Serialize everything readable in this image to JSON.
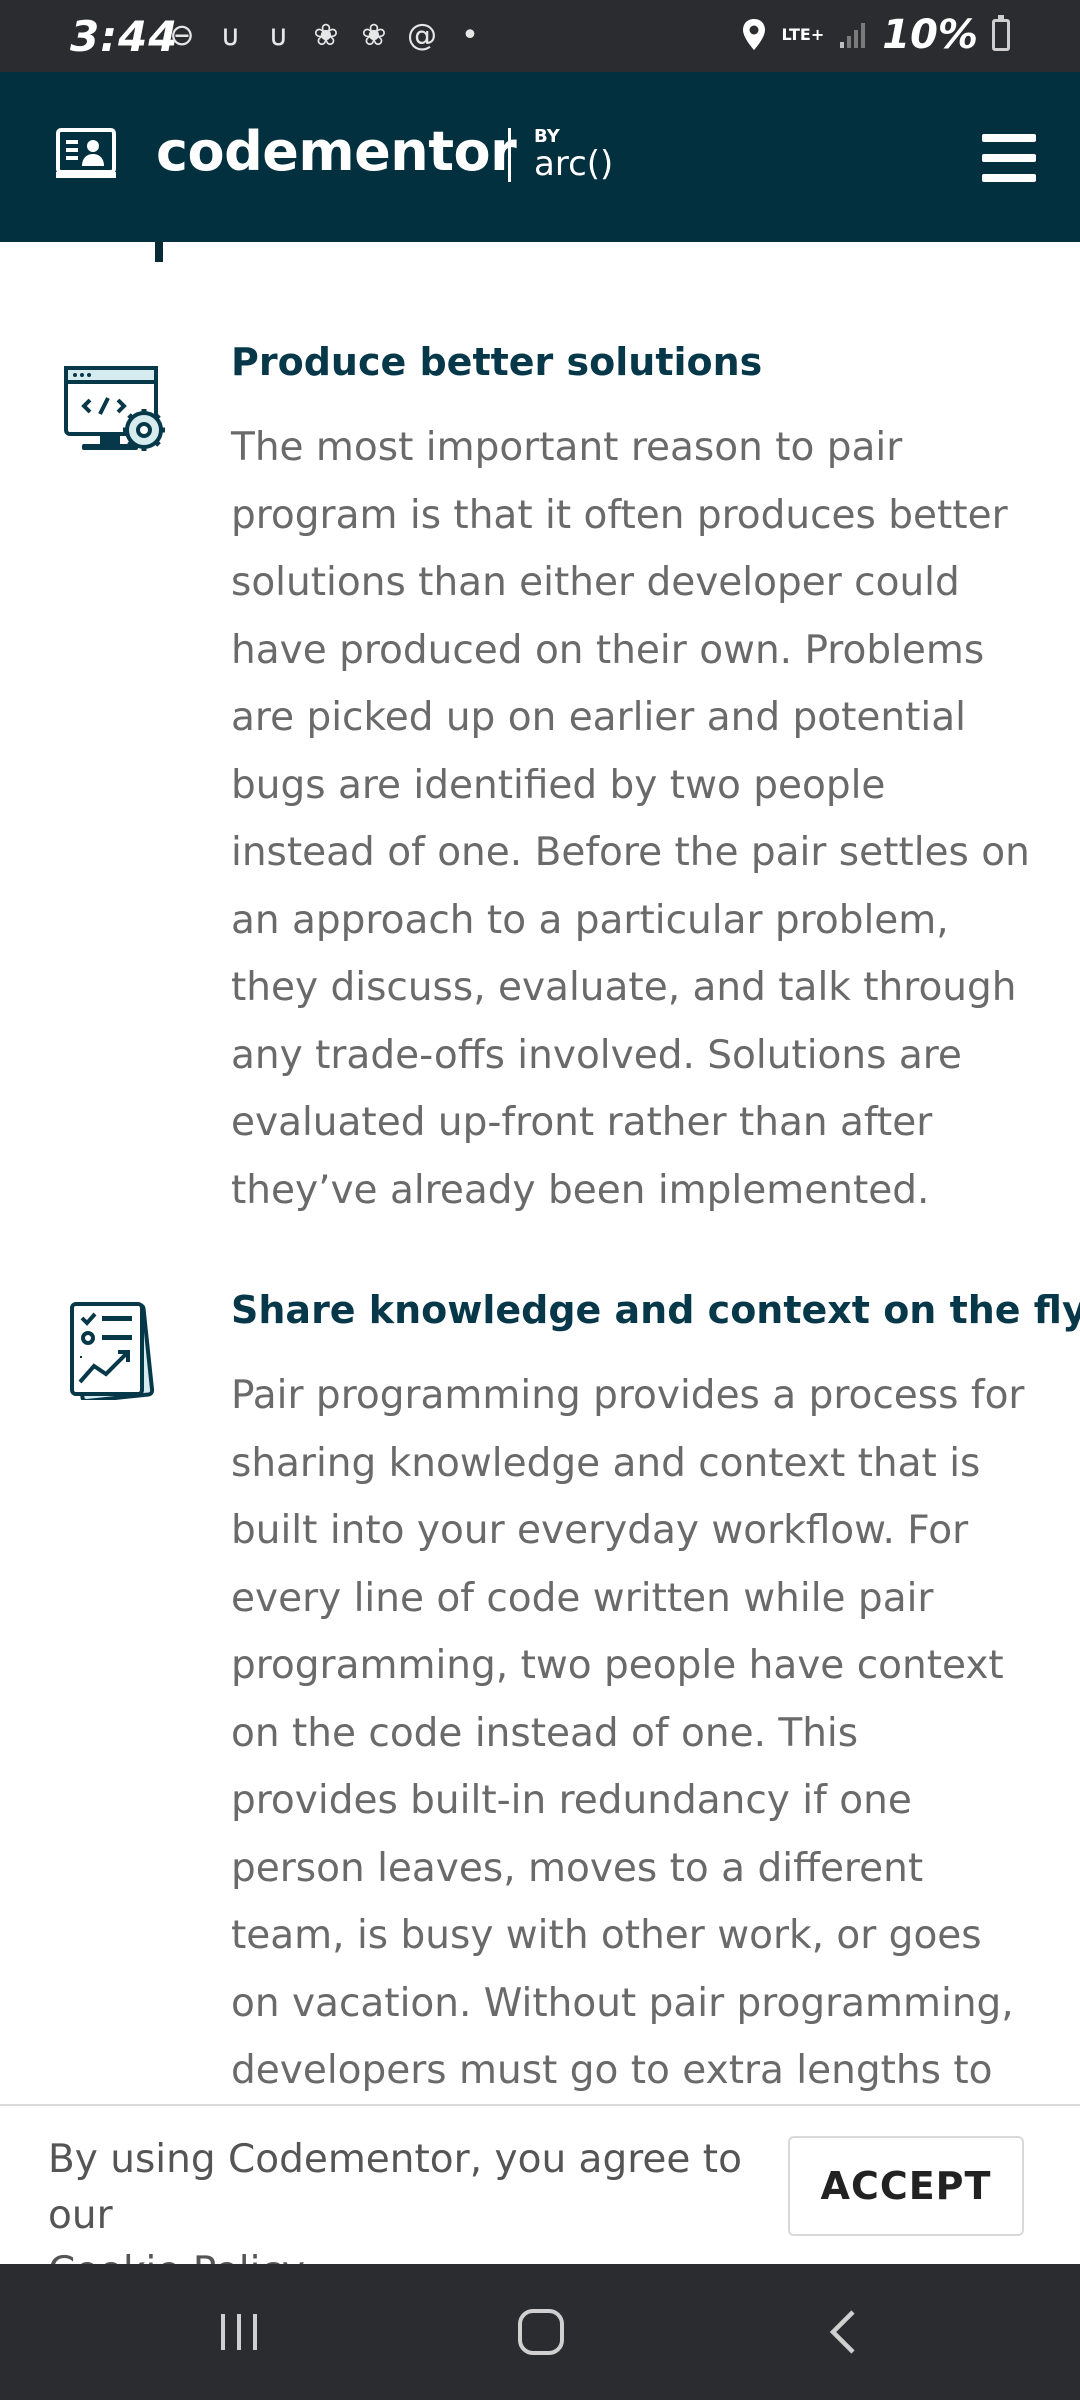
{
  "status_bar": {
    "time": "3:44",
    "network": "LTE+",
    "battery": "10%"
  },
  "header": {
    "brand": "codementor",
    "by": "BY",
    "partner": "arc()"
  },
  "features": [
    {
      "icon": "code-settings-monitor-icon",
      "title": "Produce better solutions",
      "text": "The most important reason to pair program is that it often produces better solutions than either developer could have produced on their own. Problems are picked up on earlier and potential bugs are identified by two people instead of one. Before the pair settles on an approach to a particular problem, they discuss, evaluate, and talk through any trade-offs involved. Solutions are evaluated up-front rather than after they’ve already been implemented."
    },
    {
      "icon": "checklist-report-icon",
      "title": "Share knowledge and context on the fly",
      "text": "Pair programming provides a process for sharing knowledge and context that is built into your everyday workflow. For every line of code written while pair programming, two people have context on the code instead of one. This provides built-in redundancy if one person leaves, moves to a different team, is busy with other work, or goes on vacation. Without pair programming, developers must go to extra lengths to share knowledge, usually"
    }
  ],
  "cookie": {
    "text": "By using Codementor, you agree to our",
    "link": "Cookie Policy",
    "suffix": ".",
    "accept": "ACCEPT"
  },
  "colors": {
    "header_bg": "#03303f",
    "title": "#07384a",
    "body_text": "#6a6a6a",
    "system_bar": "#2b2c30"
  }
}
